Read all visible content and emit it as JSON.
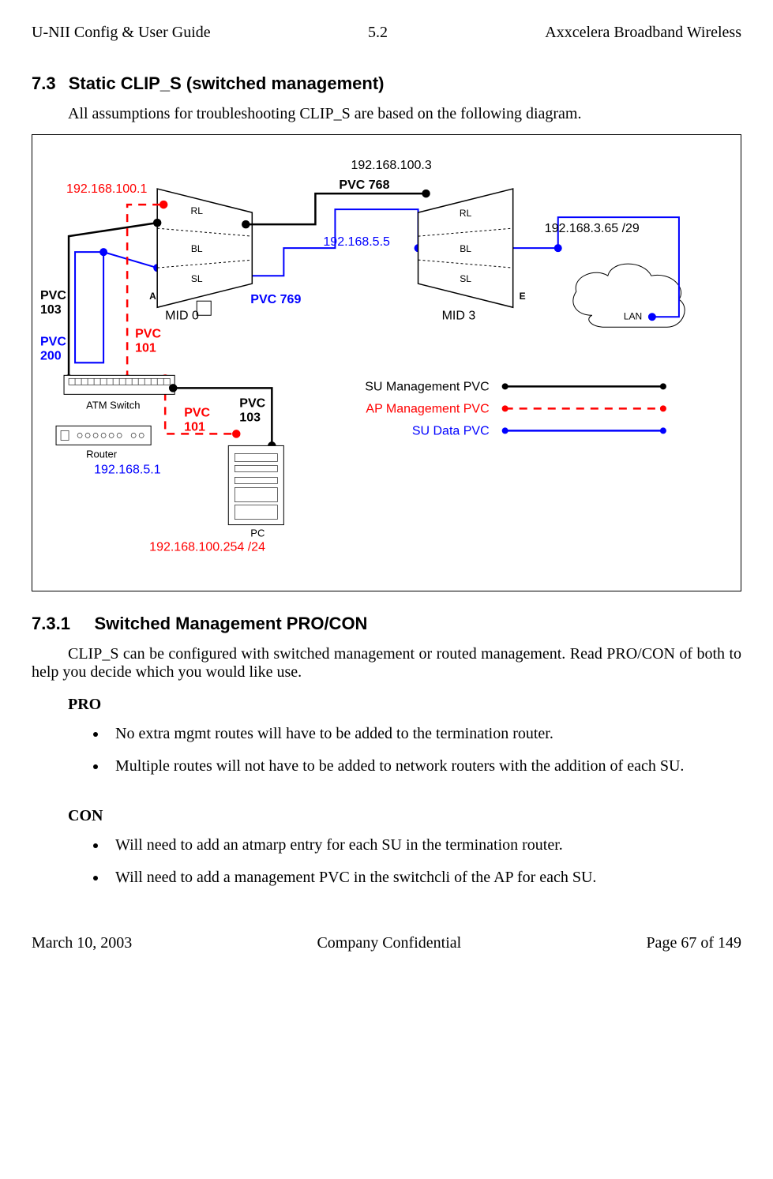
{
  "header": {
    "left": "U-NII Config & User Guide",
    "center": "5.2",
    "right": "Axxcelera Broadband Wireless"
  },
  "footer": {
    "left": "March 10, 2003",
    "center": "Company Confidential",
    "right": "Page 67 of 149"
  },
  "sec": {
    "num": "7.3",
    "title": "Static CLIP_S (switched management)"
  },
  "intro": "All assumptions for troubleshooting CLIP_S are based on the following diagram.",
  "sub": {
    "num": "7.3.1",
    "title": "Switched Management PRO/CON"
  },
  "subtext": "CLIP_S can be configured with switched management or routed management. Read PRO/CON of both to help you decide which you would like use.",
  "pro": {
    "label": "PRO",
    "items": [
      "No extra mgmt routes will have to be added to the termination router.",
      "Multiple routes will not have to be added to network routers with the addition of each SU."
    ]
  },
  "con": {
    "label": "CON",
    "items": [
      "Will need to add an atmarp entry for each SU in the termination router.",
      "Will need to add a management PVC in the switchcli of the AP for each SU."
    ]
  },
  "diagram": {
    "ip_100_1": "192.168.100.1",
    "ip_100_3": "192.168.100.3",
    "ip_5_5": "192.168.5.5",
    "ip_3_65": "192.168.3.65 /29",
    "ip_5_1": "192.168.5.1",
    "ip_100_254": "192.168.100.254 /24",
    "rl": "RL",
    "bl": "BL",
    "sl": "SL",
    "a_label": "A",
    "e_label": "E",
    "mid0": "MID 0",
    "mid3": "MID 3",
    "lan": "LAN",
    "pvc103": "PVC 103",
    "pvc200": "PVC 200",
    "pvc101": "PVC 101",
    "pvc768": "PVC 768",
    "pvc769": "PVC 769",
    "pvc101_2": "PVC 101",
    "pvc103_2": "PVC 103",
    "atm": "ATM Switch",
    "router": "Router",
    "pc": "PC",
    "leg_su_mgmt": "SU Management PVC",
    "leg_ap_mgmt": "AP Management PVC",
    "leg_su_data": "SU Data PVC"
  }
}
